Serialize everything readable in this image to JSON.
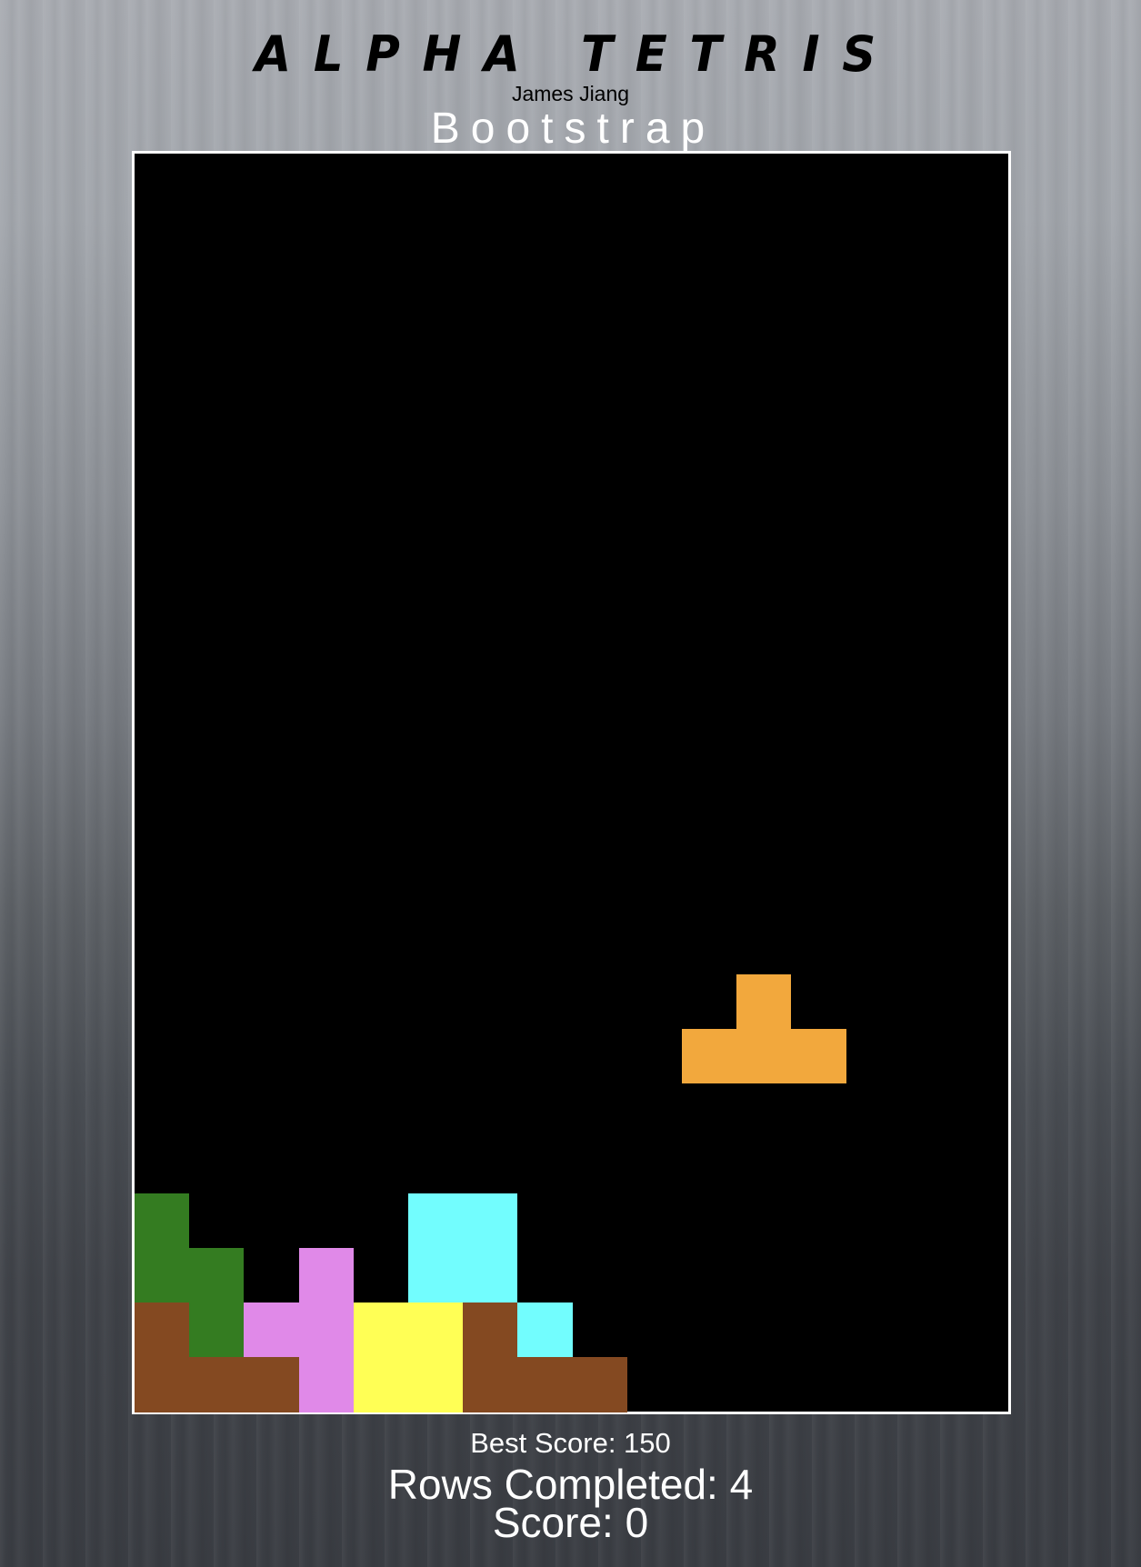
{
  "header": {
    "title": "ALPHA TETRIS",
    "author": "James Jiang",
    "subtitle": "Bootstrap"
  },
  "colors": {
    "orange": "#f2a83d",
    "green": "#347c21",
    "brown": "#844921",
    "pink": "#e089e8",
    "yellow": "#ffff55",
    "cyan": "#72fdfe",
    "board_background": "#000000",
    "board_border": "#ffffff"
  },
  "board": {
    "columns": 16,
    "rows": 23,
    "falling_piece": {
      "shape": "T",
      "color": "orange",
      "cells": [
        [
          11,
          15
        ],
        [
          10,
          16
        ],
        [
          11,
          16
        ],
        [
          12,
          16
        ]
      ]
    },
    "locked_cells": [
      {
        "col": 0,
        "row": 19,
        "color": "green"
      },
      {
        "col": 0,
        "row": 20,
        "color": "green"
      },
      {
        "col": 1,
        "row": 20,
        "color": "green"
      },
      {
        "col": 1,
        "row": 21,
        "color": "green"
      },
      {
        "col": 0,
        "row": 21,
        "color": "brown"
      },
      {
        "col": 0,
        "row": 22,
        "color": "brown"
      },
      {
        "col": 1,
        "row": 22,
        "color": "brown"
      },
      {
        "col": 2,
        "row": 22,
        "color": "brown"
      },
      {
        "col": 2,
        "row": 21,
        "color": "pink"
      },
      {
        "col": 3,
        "row": 20,
        "color": "pink"
      },
      {
        "col": 3,
        "row": 21,
        "color": "pink"
      },
      {
        "col": 3,
        "row": 22,
        "color": "pink"
      },
      {
        "col": 4,
        "row": 21,
        "color": "yellow"
      },
      {
        "col": 5,
        "row": 21,
        "color": "yellow"
      },
      {
        "col": 4,
        "row": 22,
        "color": "yellow"
      },
      {
        "col": 5,
        "row": 22,
        "color": "yellow"
      },
      {
        "col": 5,
        "row": 19,
        "color": "cyan"
      },
      {
        "col": 6,
        "row": 19,
        "color": "cyan"
      },
      {
        "col": 5,
        "row": 20,
        "color": "cyan"
      },
      {
        "col": 6,
        "row": 20,
        "color": "cyan"
      },
      {
        "col": 7,
        "row": 21,
        "color": "cyan"
      },
      {
        "col": 6,
        "row": 21,
        "color": "brown"
      },
      {
        "col": 6,
        "row": 22,
        "color": "brown"
      },
      {
        "col": 7,
        "row": 22,
        "color": "brown"
      },
      {
        "col": 8,
        "row": 22,
        "color": "brown"
      }
    ]
  },
  "stats": {
    "best_score": "Best Score: 150",
    "rows_completed": "Rows Completed: 4",
    "score": "Score: 0"
  }
}
